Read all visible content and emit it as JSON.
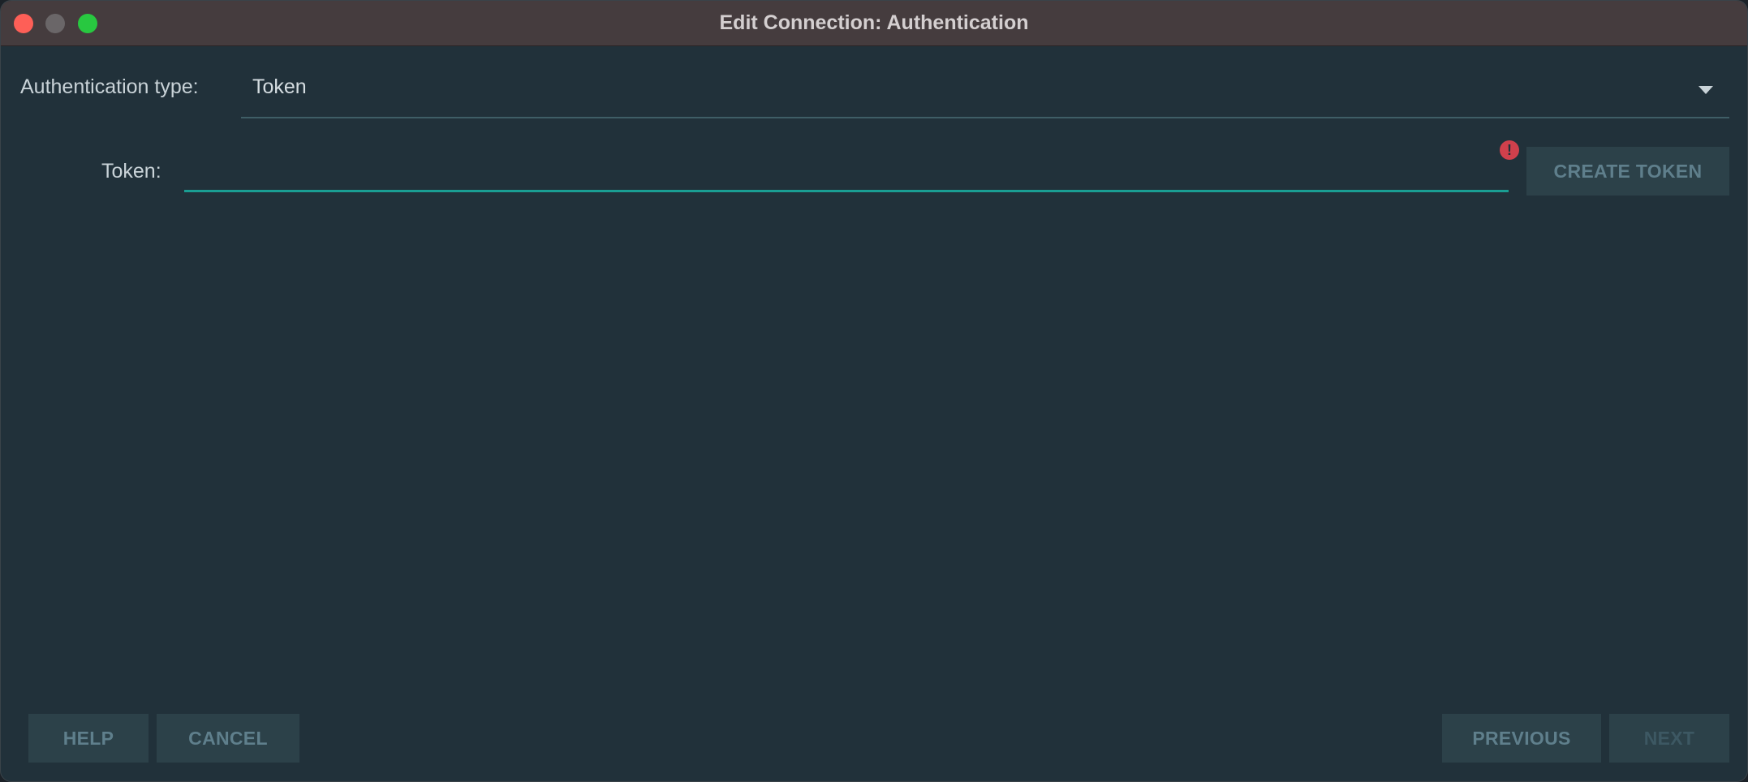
{
  "window": {
    "title": "Edit Connection: Authentication"
  },
  "form": {
    "auth_type_label": "Authentication type:",
    "auth_type_value": "Token",
    "token_label": "Token:",
    "token_value": "",
    "token_placeholder": "",
    "token_error_icon": "!",
    "create_token_label": "CREATE TOKEN"
  },
  "footer": {
    "help_label": "HELP",
    "cancel_label": "CANCEL",
    "previous_label": "PREVIOUS",
    "next_label": "NEXT"
  },
  "colors": {
    "background": "#21313a",
    "titlebar": "#453c3e",
    "accent": "#1a9e93",
    "error": "#d0404c",
    "button_bg": "#2c4149",
    "button_text": "#5f7f8c"
  },
  "icons": {
    "close": "close-icon",
    "minimize": "minimize-icon",
    "maximize": "maximize-icon",
    "dropdown": "caret-down-icon",
    "error": "error-icon"
  }
}
